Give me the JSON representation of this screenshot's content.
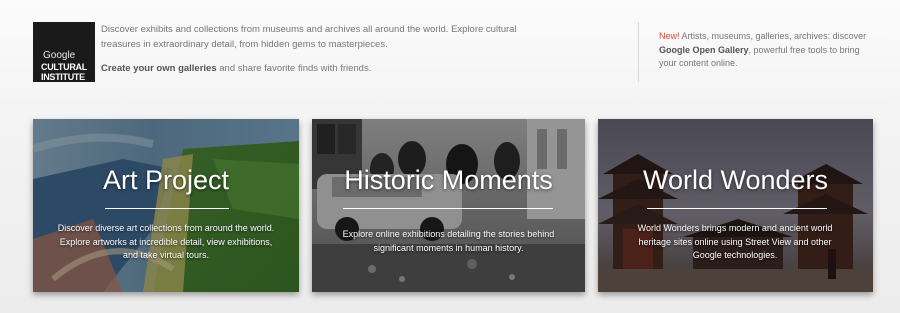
{
  "logo": {
    "google": "Google",
    "line1": "CULTURAL",
    "line2": "INSTITUTE"
  },
  "intro": {
    "text1": "Discover exhibits and collections from museums and archives all around the world. Explore cultural treasures in extraordinary detail, from hidden gems to masterpieces.",
    "link": "Create your own galleries",
    "text2": " and share favorite finds with friends."
  },
  "news": {
    "new_label": "New!",
    "text1": " Artists, museums, galleries, archives: discover ",
    "link": "Google Open Gallery",
    "text2": ", powerful free tools to bring your content online."
  },
  "cards": [
    {
      "title": "Art Project",
      "description": "Discover diverse art collections from around the world. Explore artworks at incredible detail, view exhibitions, and take virtual tours."
    },
    {
      "title": "Historic Moments",
      "description": "Explore online exhibitions detailing the stories behind significant moments in human history."
    },
    {
      "title": "World Wonders",
      "description": "World Wonders brings modern and ancient world heritage sites online using Street View and other Google technologies."
    }
  ],
  "colors": {
    "new": "#dd4b39",
    "text": "#777777",
    "strong": "#555555",
    "logo_bg": "#1a1a1a"
  }
}
